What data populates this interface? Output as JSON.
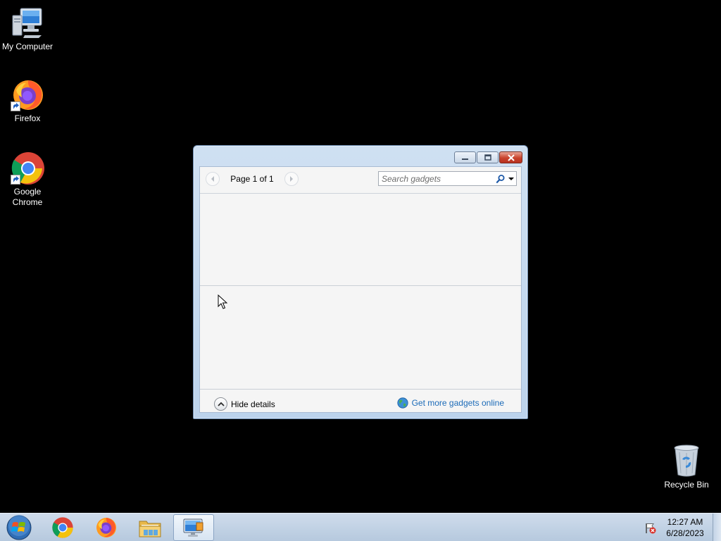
{
  "desktop": {
    "icons": [
      {
        "label": "My Computer",
        "icon": "computer-icon"
      },
      {
        "label": "Firefox",
        "icon": "firefox-icon"
      },
      {
        "label": "Google Chrome",
        "icon": "chrome-icon"
      },
      {
        "label": "Recycle Bin",
        "icon": "recycle-bin-icon"
      }
    ]
  },
  "gadgets_window": {
    "pager": {
      "text": "Page 1 of 1"
    },
    "search": {
      "placeholder": "Search gadgets",
      "value": ""
    },
    "footer": {
      "hide_details": "Hide details",
      "get_more": "Get more gadgets online"
    },
    "controls": [
      "minimize",
      "maximize",
      "close"
    ]
  },
  "taskbar": {
    "pinned": [
      "start-orb",
      "chrome-icon",
      "firefox-icon",
      "explorer-icon",
      "gadgets-icon"
    ],
    "clock": {
      "time": "12:27 AM",
      "date": "6/28/2023"
    }
  },
  "colors": {
    "desktop_bg": "#000000",
    "link": "#1c6bb8",
    "close_red": "#c9432d",
    "taskbar": "#c3d3e6"
  }
}
